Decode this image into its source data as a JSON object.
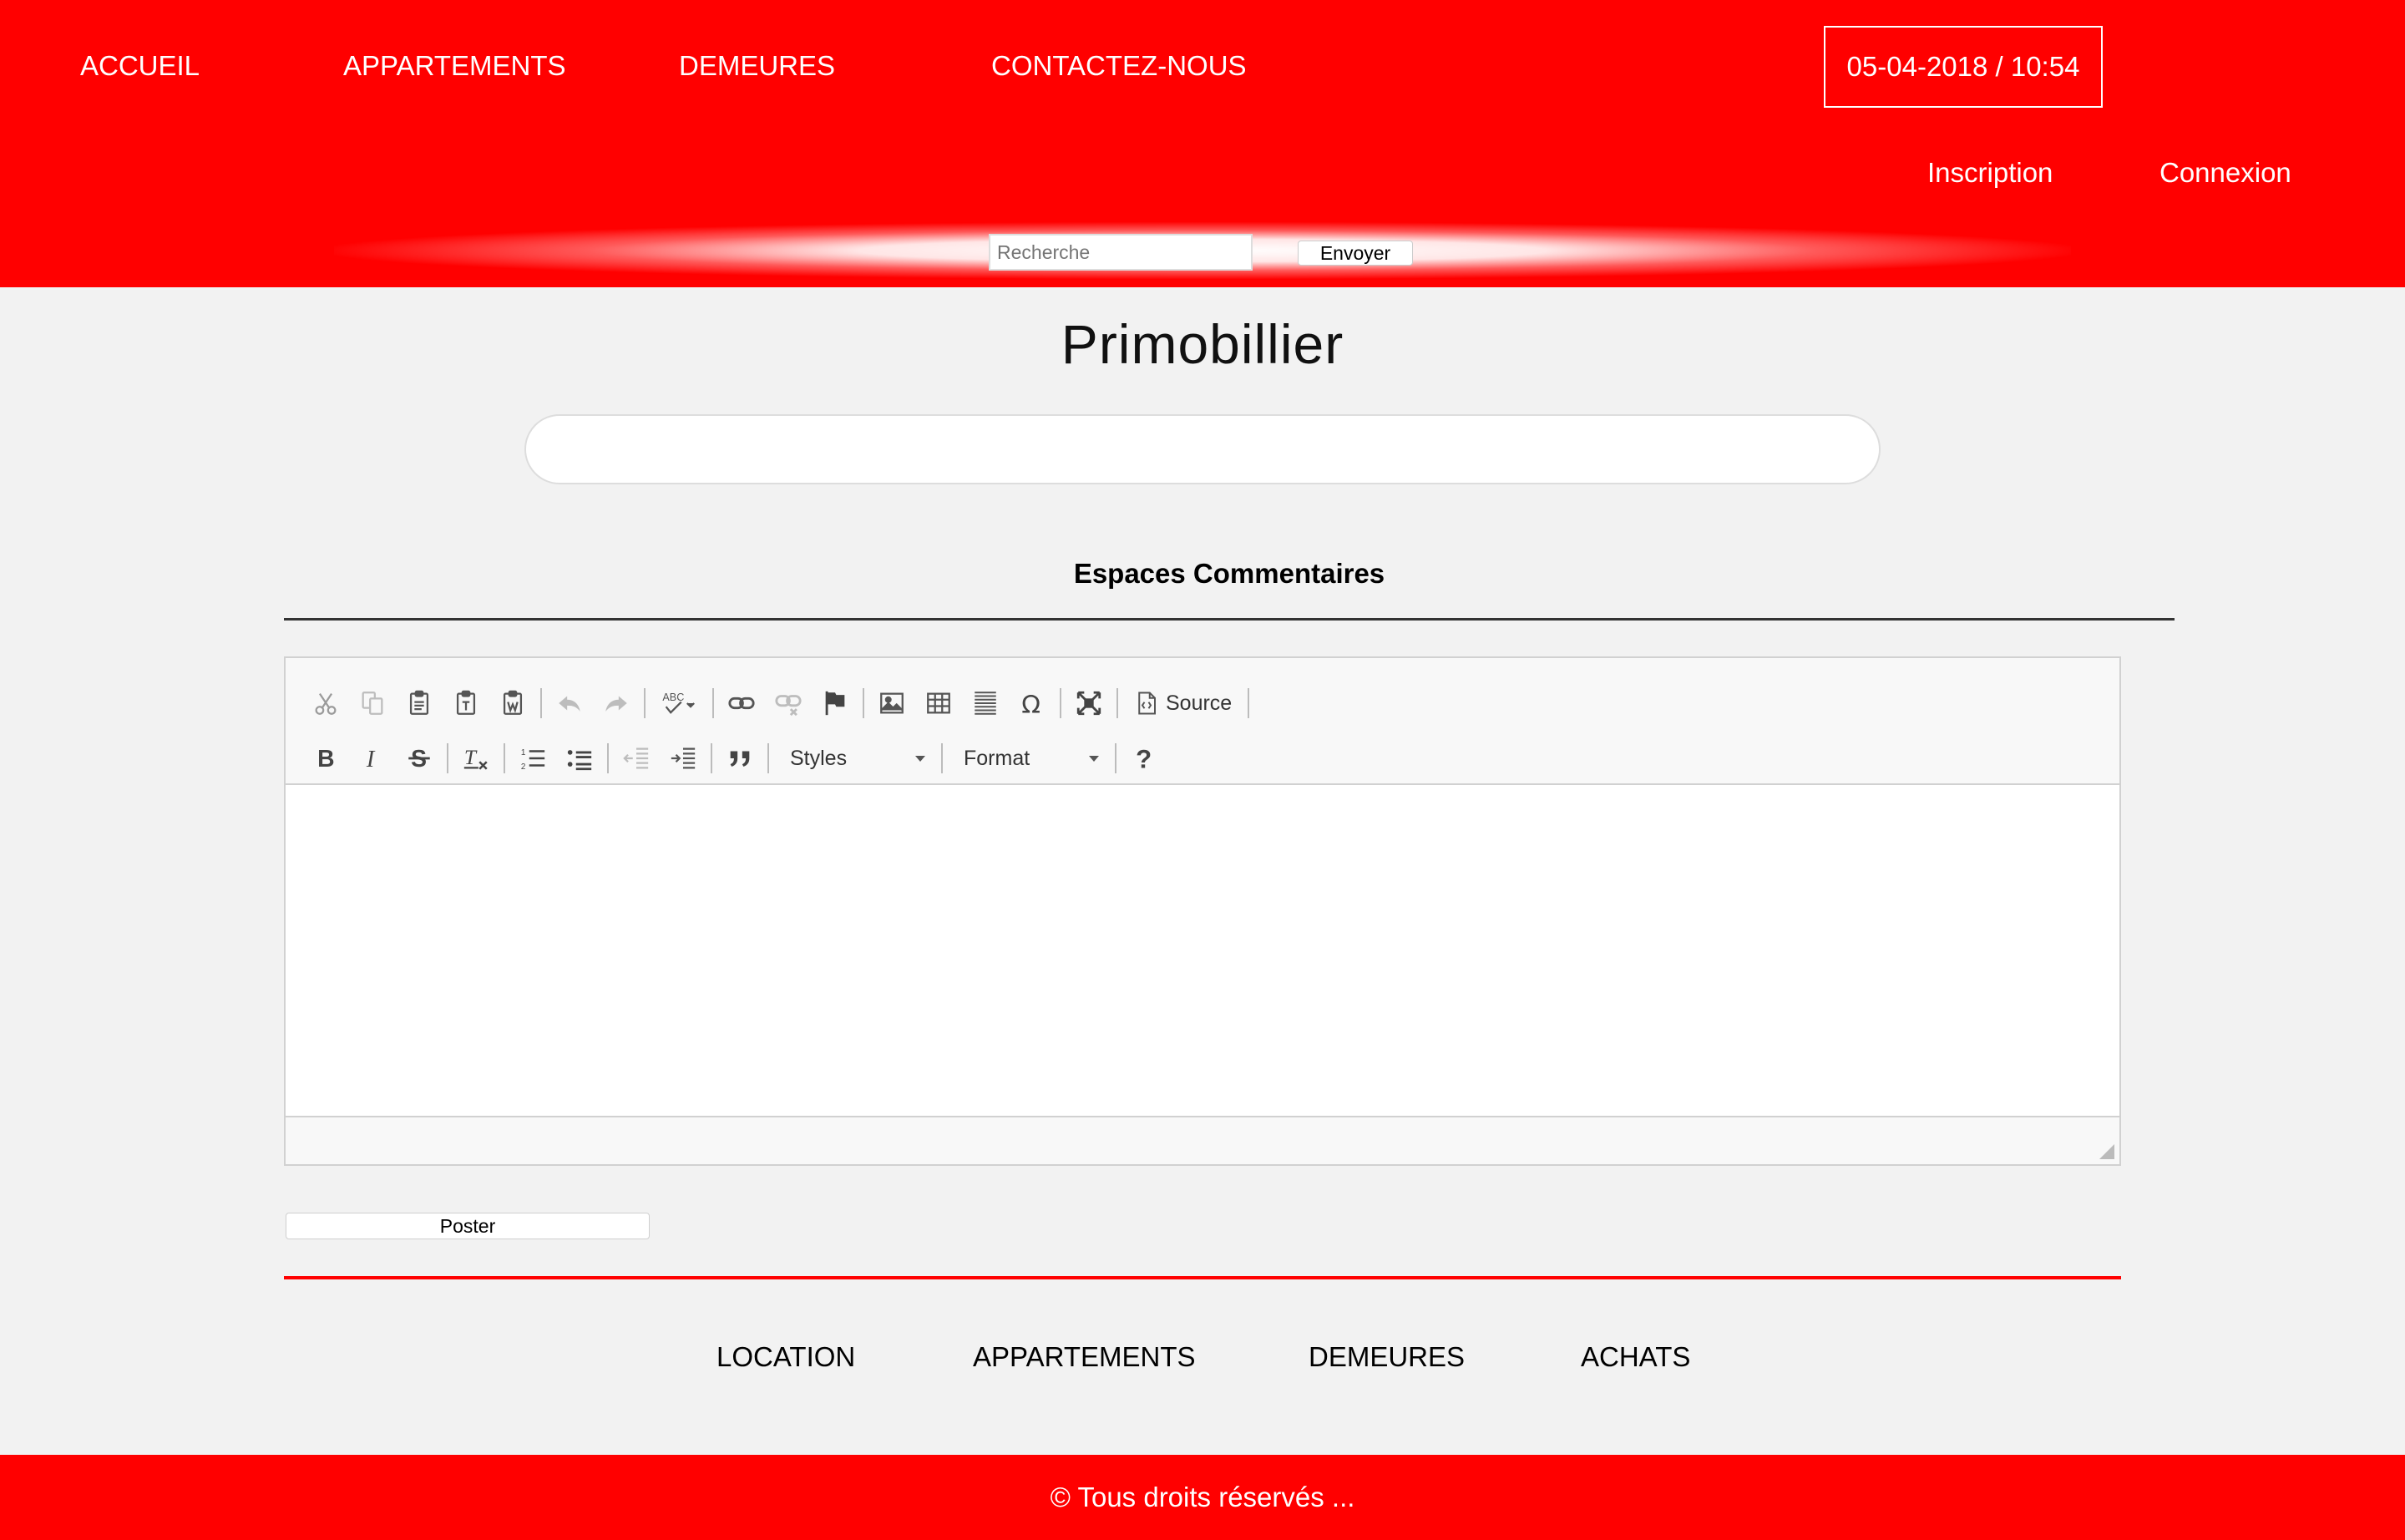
{
  "header": {
    "nav": [
      "ACCUEIL",
      "APPARTEMENTS",
      "DEMEURES",
      "CONTACTEZ-NOUS"
    ],
    "datetime": "05-04-2018 / 10:54",
    "auth": {
      "register": "Inscription",
      "login": "Connexion"
    },
    "search": {
      "placeholder": "Recherche",
      "button": "Envoyer"
    }
  },
  "main": {
    "title": "Primobillier",
    "comments_heading": "Espaces Commentaires",
    "editor": {
      "source_label": "Source",
      "styles_label": "Styles",
      "format_label": "Format"
    },
    "post_button": "Poster"
  },
  "footer_links": [
    "LOCATION",
    "APPARTEMENTS",
    "DEMEURES",
    "ACHATS"
  ],
  "footer": {
    "copyright": "© Tous droits réservés ..."
  },
  "colors": {
    "brand": "#ff0000",
    "background": "#f2f2f2",
    "separator": "#333333"
  }
}
